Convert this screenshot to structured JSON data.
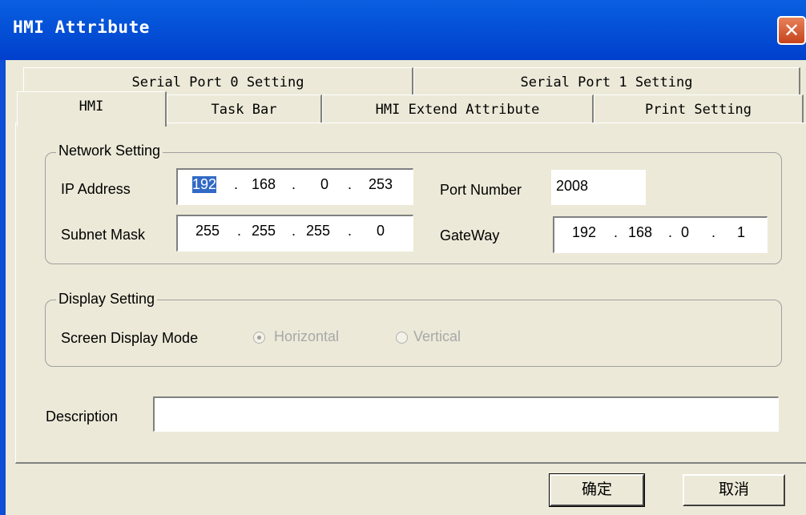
{
  "window": {
    "title": "HMI Attribute",
    "close_glyph": "✕"
  },
  "tabs": {
    "row1": [
      {
        "label": "Serial Port 0 Setting"
      },
      {
        "label": "Serial Port 1 Setting"
      }
    ],
    "row2": [
      {
        "label": "HMI",
        "active": true
      },
      {
        "label": "Task Bar"
      },
      {
        "label": "HMI Extend Attribute"
      },
      {
        "label": "Print Setting"
      }
    ]
  },
  "network": {
    "legend": "Network Setting",
    "ip_label": "IP Address",
    "ip": [
      "192",
      "168",
      "0",
      "253"
    ],
    "subnet_label": "Subnet Mask",
    "subnet": [
      "255",
      "255",
      "255",
      "0"
    ],
    "port_label": "Port Number",
    "port": "2008",
    "gateway_label": "GateWay",
    "gateway": [
      "192",
      "168",
      "0",
      "1"
    ],
    "dot": "."
  },
  "display": {
    "legend": "Display Setting",
    "mode_label": "Screen Display Mode",
    "options": [
      "Horizontal",
      "Vertical"
    ],
    "selected": "Horizontal"
  },
  "description": {
    "label": "Description",
    "value": ""
  },
  "buttons": {
    "ok": "确定",
    "cancel": "取消"
  },
  "icons": {
    "close": "close-icon",
    "radio": "radio-button"
  }
}
